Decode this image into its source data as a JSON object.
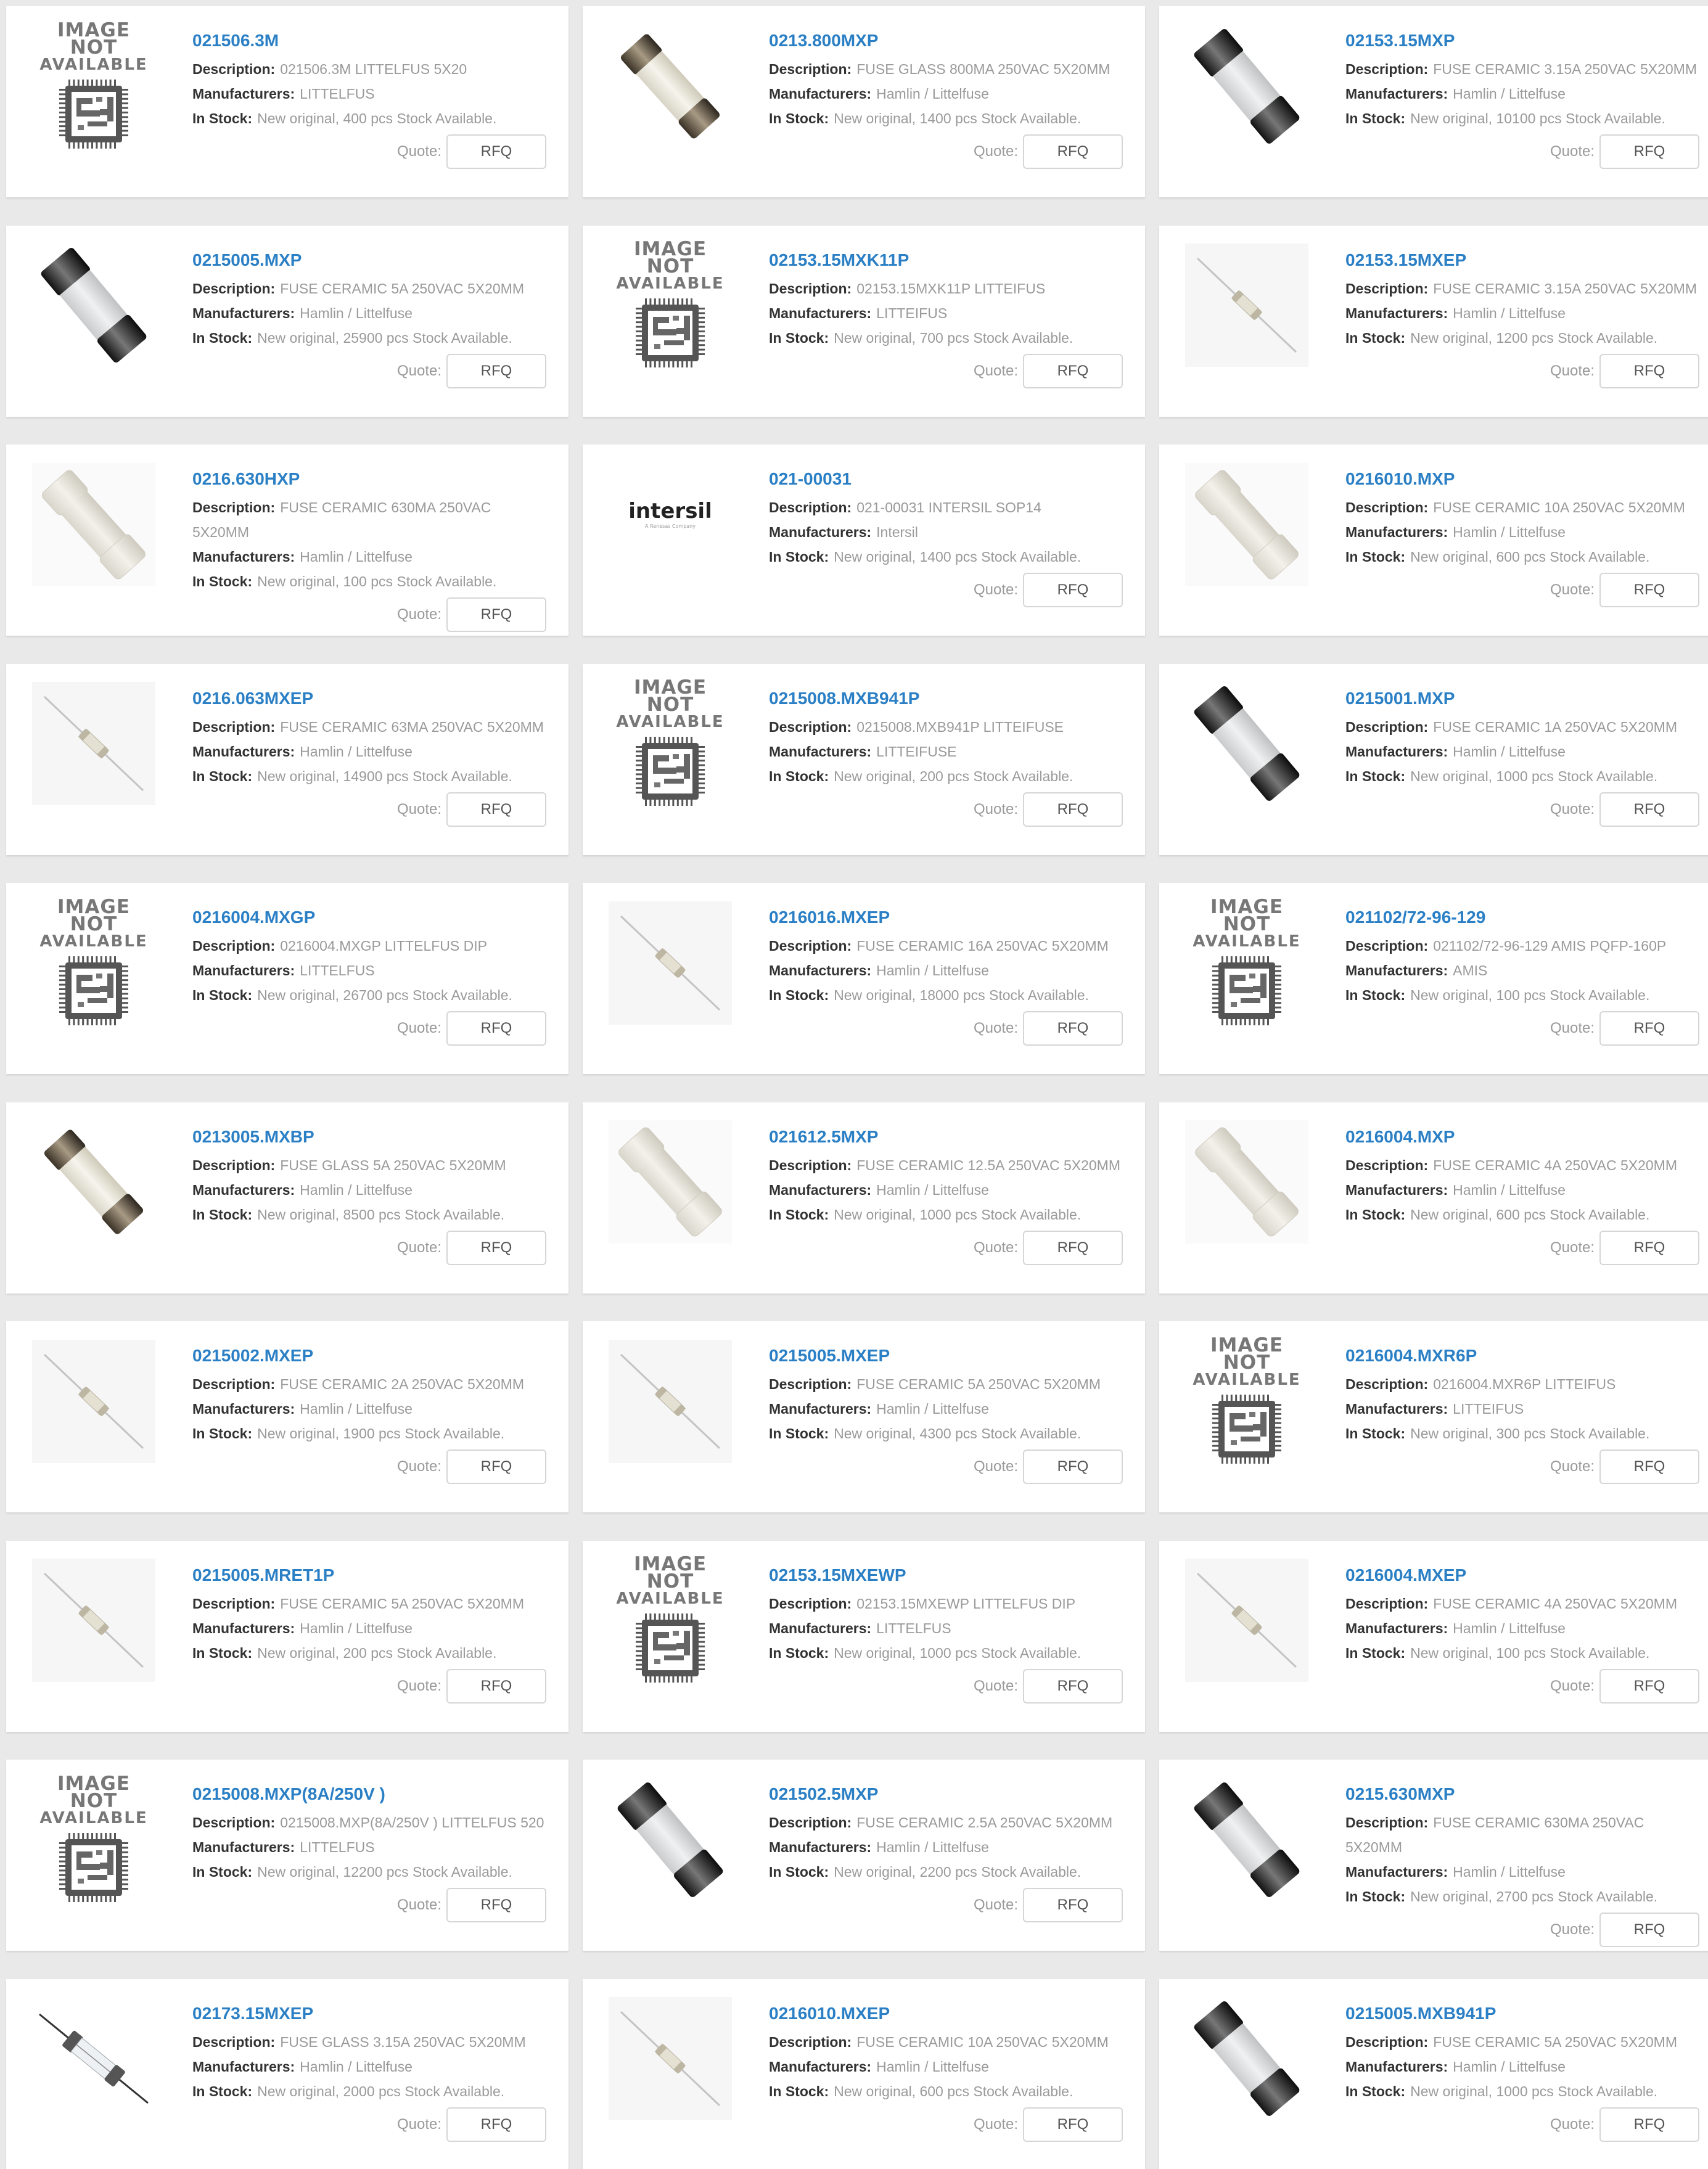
{
  "labels": {
    "description": "Description:",
    "manufacturers": "Manufacturers:",
    "in_stock": "In Stock:",
    "quote": "Quote:",
    "rfq": "RFQ",
    "na_line1": "IMAGE NOT",
    "na_line2": "AVAILABLE"
  },
  "products": [
    {
      "pn": "021506.3M",
      "desc": "021506.3M LITTELFUS 5X20",
      "mfr": "LITTELFUS",
      "stock": "New original, 400 pcs Stock Available.",
      "image": "not-available"
    },
    {
      "pn": "0213.800MXP",
      "desc": "FUSE GLASS 800MA 250VAC 5X20MM",
      "mfr": "Hamlin / Littelfuse",
      "stock": "New original, 1400 pcs Stock Available.",
      "image": "glass-fuse"
    },
    {
      "pn": "02153.15MXP",
      "desc": "FUSE CERAMIC 3.15A 250VAC 5X20MM",
      "mfr": "Hamlin / Littelfuse",
      "stock": "New original, 10100 pcs Stock Available.",
      "image": "black-cap-fuse"
    },
    {
      "pn": "0215005.MXP",
      "desc": "FUSE CERAMIC 5A 250VAC 5X20MM",
      "mfr": "Hamlin / Littelfuse",
      "stock": "New original, 25900 pcs Stock Available.",
      "image": "black-cap-fuse"
    },
    {
      "pn": "02153.15MXK11P",
      "desc": "02153.15MXK11P LITTEIFUS",
      "mfr": "LITTEIFUS",
      "stock": "New original, 700 pcs Stock Available.",
      "image": "not-available"
    },
    {
      "pn": "02153.15MXEP",
      "desc": "FUSE CERAMIC 3.15A 250VAC 5X20MM",
      "mfr": "Hamlin / Littelfuse",
      "stock": "New original, 1200 pcs Stock Available.",
      "image": "axial-fuse"
    },
    {
      "pn": "0216.630HXP",
      "desc": "FUSE CERAMIC 630MA 250VAC 5X20MM",
      "mfr": "Hamlin / Littelfuse",
      "stock": "New original, 100 pcs Stock Available.",
      "image": "white-ceramic-fuse",
      "wrap": true
    },
    {
      "pn": "021-00031",
      "desc": "021-00031 INTERSIL SOP14",
      "mfr": "Intersil",
      "stock": "New original, 1400 pcs Stock Available.",
      "image": "intersil-logo"
    },
    {
      "pn": "0216010.MXP",
      "desc": "FUSE CERAMIC 10A 250VAC 5X20MM",
      "mfr": "Hamlin / Littelfuse",
      "stock": "New original, 600 pcs Stock Available.",
      "image": "white-ceramic-fuse"
    },
    {
      "pn": "0216.063MXEP",
      "desc": "FUSE CERAMIC 63MA 250VAC 5X20MM",
      "mfr": "Hamlin / Littelfuse",
      "stock": "New original, 14900 pcs Stock Available.",
      "image": "axial-fuse"
    },
    {
      "pn": "0215008.MXB941P",
      "desc": "0215008.MXB941P LITTEIFUSE",
      "mfr": "LITTEIFUSE",
      "stock": "New original, 200 pcs Stock Available.",
      "image": "not-available"
    },
    {
      "pn": "0215001.MXP",
      "desc": "FUSE CERAMIC 1A 250VAC 5X20MM",
      "mfr": "Hamlin / Littelfuse",
      "stock": "New original, 1000 pcs Stock Available.",
      "image": "black-cap-fuse"
    },
    {
      "pn": "0216004.MXGP",
      "desc": "0216004.MXGP LITTELFUS DIP",
      "mfr": "LITTELFUS",
      "stock": "New original, 26700 pcs Stock Available.",
      "image": "not-available"
    },
    {
      "pn": "0216016.MXEP",
      "desc": "FUSE CERAMIC 16A 250VAC 5X20MM",
      "mfr": "Hamlin / Littelfuse",
      "stock": "New original, 18000 pcs Stock Available.",
      "image": "axial-fuse"
    },
    {
      "pn": "021102/72-96-129",
      "desc": "021102/72-96-129 AMIS PQFP-160P",
      "mfr": "AMIS",
      "stock": "New original, 100 pcs Stock Available.",
      "image": "not-available"
    },
    {
      "pn": "0213005.MXBP",
      "desc": "FUSE GLASS 5A 250VAC 5X20MM",
      "mfr": "Hamlin / Littelfuse",
      "stock": "New original, 8500 pcs Stock Available.",
      "image": "glass-fuse"
    },
    {
      "pn": "021612.5MXP",
      "desc": "FUSE CERAMIC 12.5A 250VAC 5X20MM",
      "mfr": "Hamlin / Littelfuse",
      "stock": "New original, 1000 pcs Stock Available.",
      "image": "white-ceramic-fuse"
    },
    {
      "pn": "0216004.MXP",
      "desc": "FUSE CERAMIC 4A 250VAC 5X20MM",
      "mfr": "Hamlin / Littelfuse",
      "stock": "New original, 600 pcs Stock Available.",
      "image": "white-ceramic-fuse"
    },
    {
      "pn": "0215002.MXEP",
      "desc": "FUSE CERAMIC 2A 250VAC 5X20MM",
      "mfr": "Hamlin / Littelfuse",
      "stock": "New original, 1900 pcs Stock Available.",
      "image": "axial-fuse"
    },
    {
      "pn": "0215005.MXEP",
      "desc": "FUSE CERAMIC 5A 250VAC 5X20MM",
      "mfr": "Hamlin / Littelfuse",
      "stock": "New original, 4300 pcs Stock Available.",
      "image": "axial-fuse"
    },
    {
      "pn": "0216004.MXR6P",
      "desc": "0216004.MXR6P LITTEIFUS",
      "mfr": "LITTEIFUS",
      "stock": "New original, 300 pcs Stock Available.",
      "image": "not-available"
    },
    {
      "pn": "0215005.MRET1P",
      "desc": "FUSE CERAMIC 5A 250VAC 5X20MM",
      "mfr": "Hamlin / Littelfuse",
      "stock": "New original, 200 pcs Stock Available.",
      "image": "axial-fuse"
    },
    {
      "pn": "02153.15MXEWP",
      "desc": "02153.15MXEWP LITTELFUS DIP",
      "mfr": "LITTELFUS",
      "stock": "New original, 1000 pcs Stock Available.",
      "image": "not-available"
    },
    {
      "pn": "0216004.MXEP",
      "desc": "FUSE CERAMIC 4A 250VAC 5X20MM",
      "mfr": "Hamlin / Littelfuse",
      "stock": "New original, 100 pcs Stock Available.",
      "image": "axial-fuse"
    },
    {
      "pn": "0215008.MXP(8A/250V )",
      "desc": "0215008.MXP(8A/250V ) LITTELFUS 520",
      "mfr": "LITTELFUS",
      "stock": "New original, 12200 pcs Stock Available.",
      "image": "not-available"
    },
    {
      "pn": "021502.5MXP",
      "desc": "FUSE CERAMIC 2.5A 250VAC 5X20MM",
      "mfr": "Hamlin / Littelfuse",
      "stock": "New original, 2200 pcs Stock Available.",
      "image": "black-cap-fuse"
    },
    {
      "pn": "0215.630MXP",
      "desc": "FUSE CERAMIC 630MA 250VAC 5X20MM",
      "mfr": "Hamlin / Littelfuse",
      "stock": "New original, 2700 pcs Stock Available.",
      "image": "black-cap-fuse",
      "wrap": true
    },
    {
      "pn": "02173.15MXEP",
      "desc": "FUSE GLASS 3.15A 250VAC 5X20MM",
      "mfr": "Hamlin / Littelfuse",
      "stock": "New original, 2000 pcs Stock Available.",
      "image": "glass-axial-fuse"
    },
    {
      "pn": "0216010.MXEP",
      "desc": "FUSE CERAMIC 10A 250VAC 5X20MM",
      "mfr": "Hamlin / Littelfuse",
      "stock": "New original, 600 pcs Stock Available.",
      "image": "axial-fuse"
    },
    {
      "pn": "0215005.MXB941P",
      "desc": "FUSE CERAMIC 5A 250VAC 5X20MM",
      "mfr": "Hamlin / Littelfuse",
      "stock": "New original, 1000 pcs Stock Available.",
      "image": "black-cap-fuse"
    }
  ],
  "intersil_logo": {
    "word": "intersil",
    "tagline": "A Renesas Company"
  },
  "colors": {
    "link": "#2a7fc5",
    "label": "#333333",
    "muted": "#9a9a9a",
    "background": "#e9e9e9",
    "card": "#ffffff"
  }
}
